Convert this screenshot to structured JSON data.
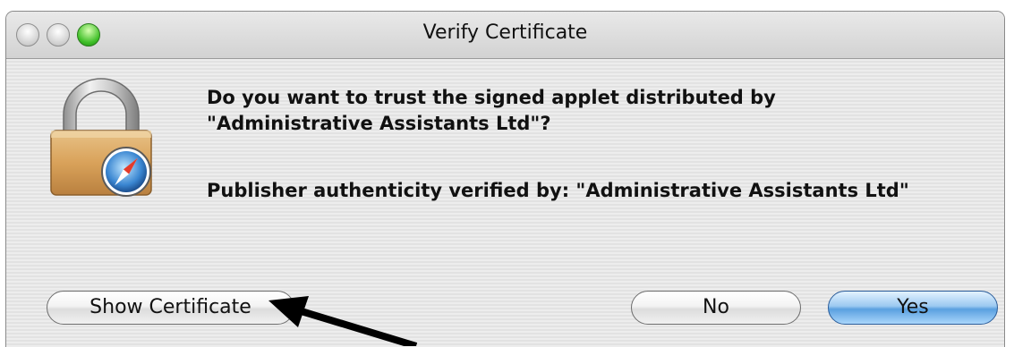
{
  "window": {
    "title": "Verify Certificate"
  },
  "dialog": {
    "question": "Do you want to trust the signed applet distributed by \"Administrative Assistants Ltd\"?",
    "verified": "Publisher authenticity verified by: \"Administrative Assistants Ltd\"",
    "icon": "lock-icon"
  },
  "buttons": {
    "show_certificate": "Show Certificate",
    "no": "No",
    "yes": "Yes"
  },
  "annotation": {
    "arrow_color": "#000000",
    "arrow_target": "show-certificate-button"
  },
  "colors": {
    "default_button": "#5aa0e0",
    "zoom_light": "#3fbf28"
  }
}
